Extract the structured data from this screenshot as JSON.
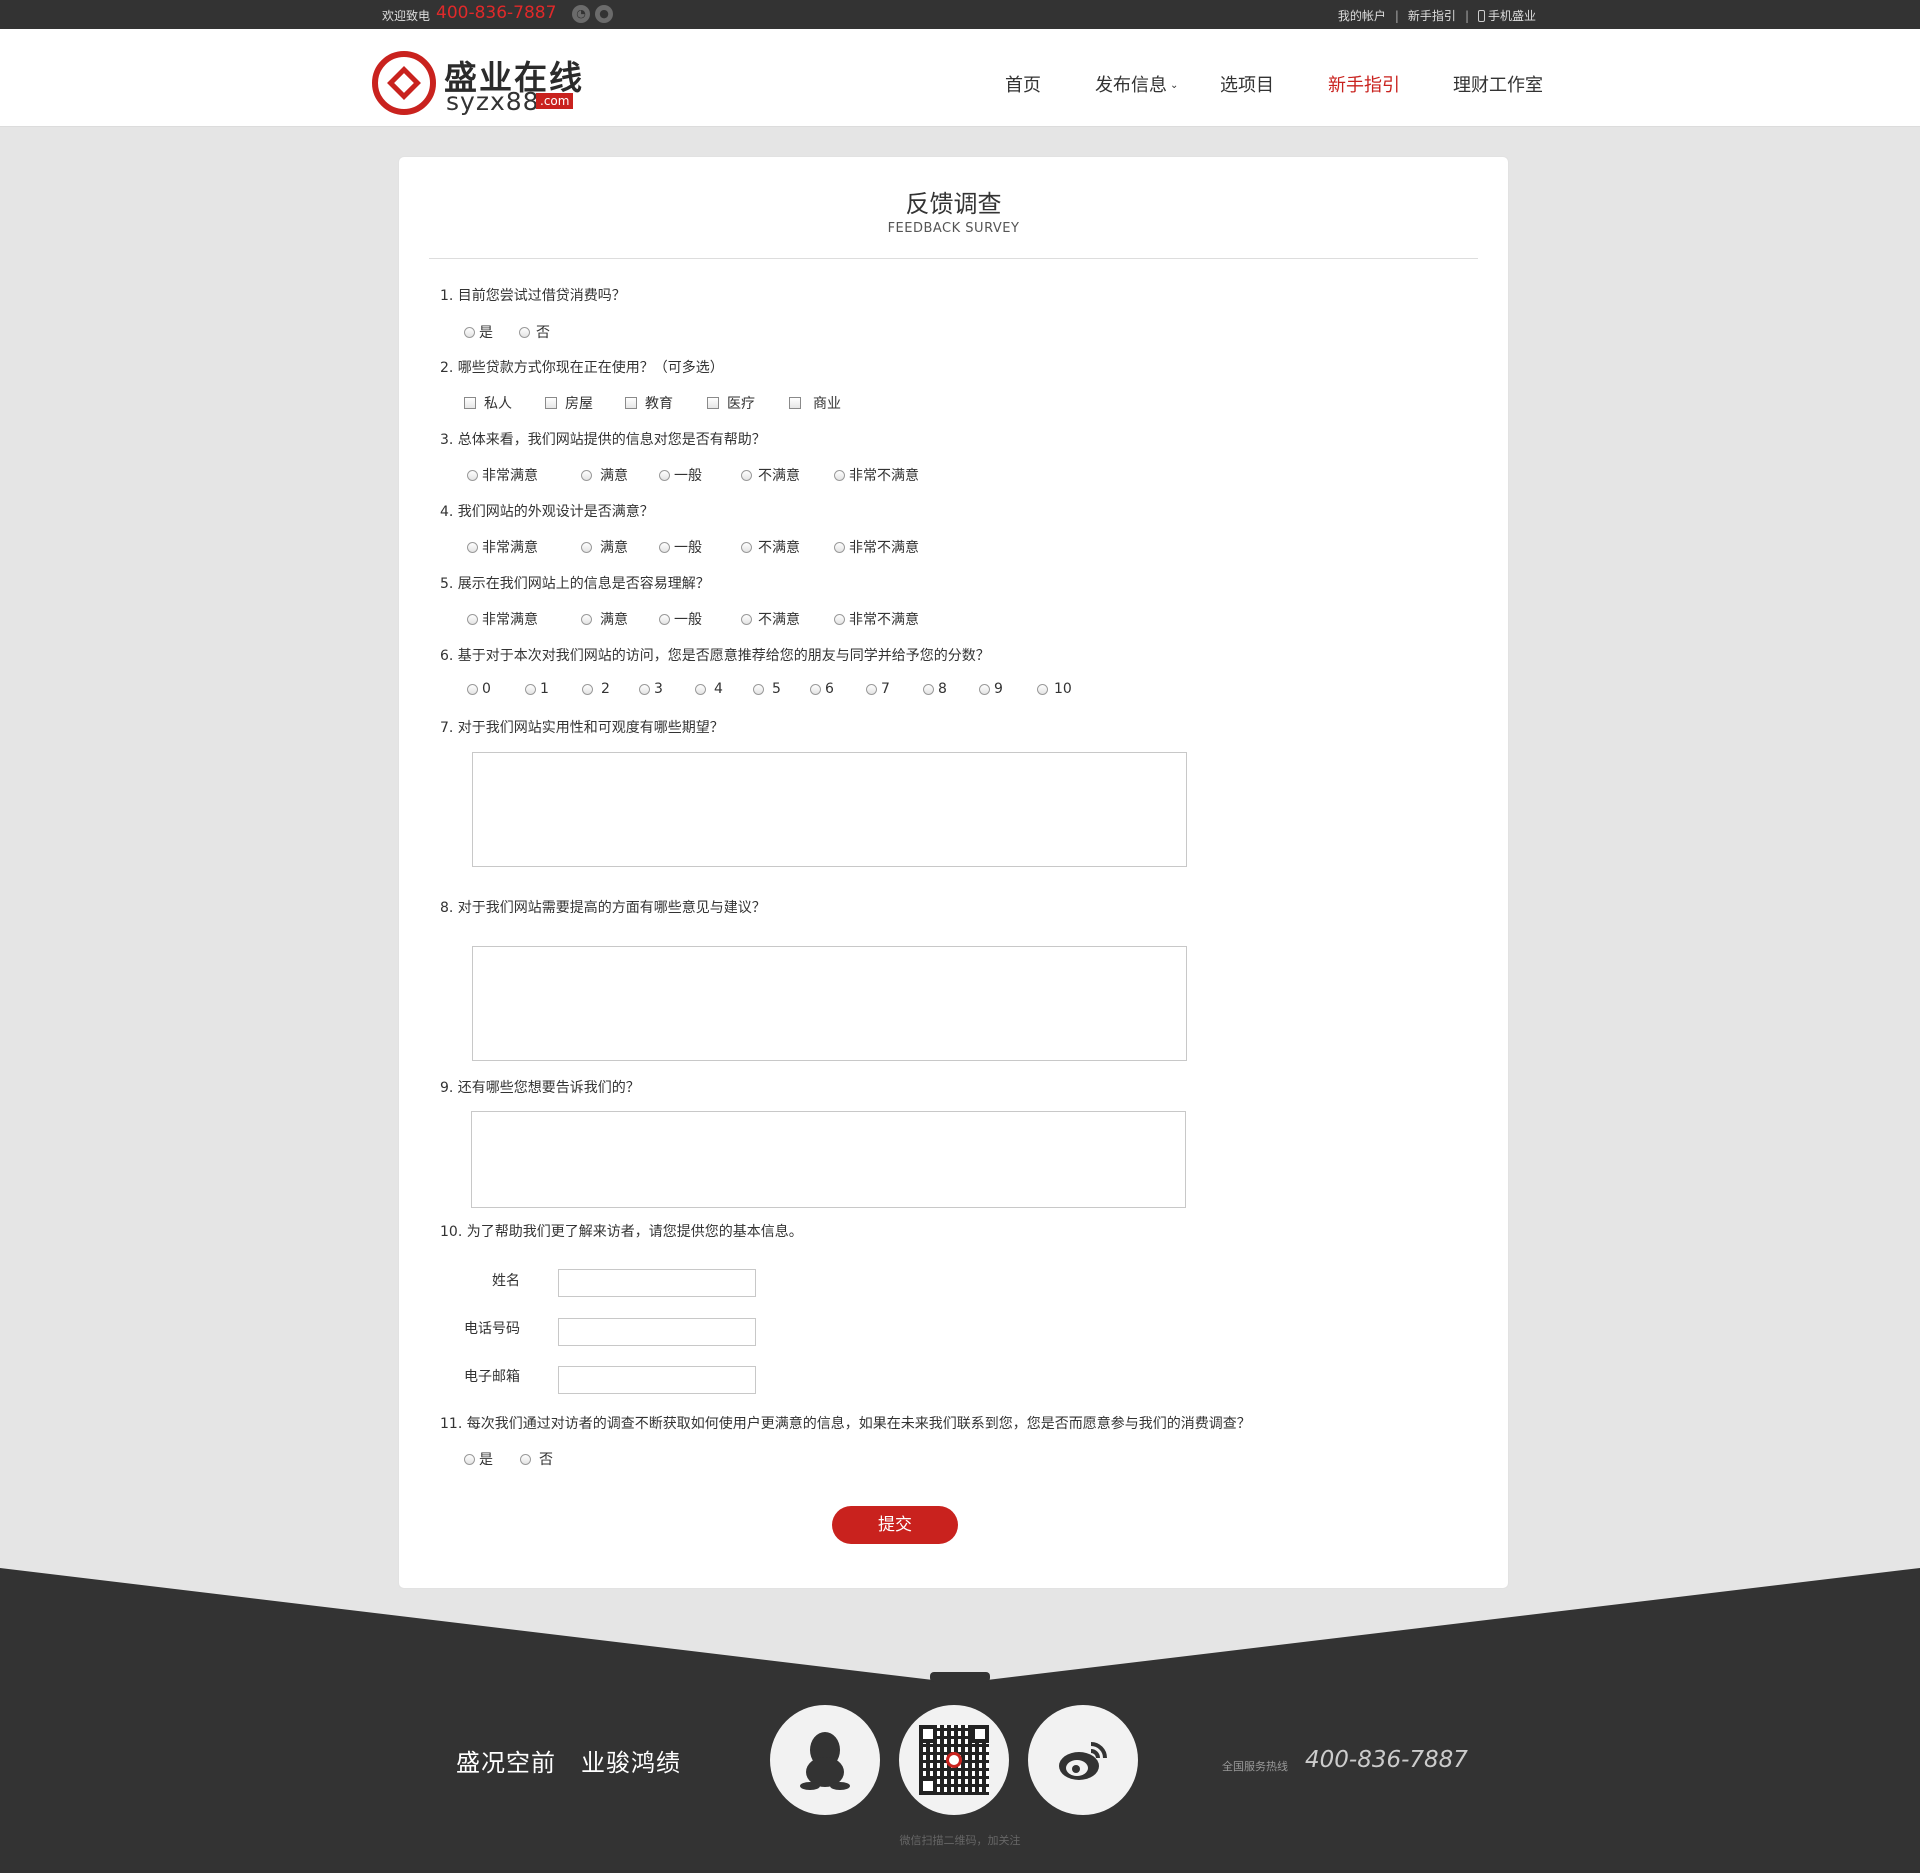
{
  "topbar": {
    "welcome": "欢迎致电",
    "phone": "400-836-7887",
    "links": [
      "我的帐户",
      "新手指引",
      "手机盛业"
    ]
  },
  "header": {
    "logo_cn": "盛业在线",
    "logo_en": "syzx88",
    "logo_com": ".com",
    "nav": [
      "首页",
      "发布信息",
      "选项目",
      "新手指引",
      "理财工作室"
    ],
    "nav_active": "新手指引"
  },
  "survey": {
    "title": "反馈调查",
    "subtitle": "FEEDBACK SURVEY",
    "q1": {
      "text": "1. 目前您尝试过借贷消费吗？",
      "options": [
        "是",
        "否"
      ]
    },
    "q2": {
      "text": "2. 哪些贷款方式你现在正在使用？（可多选）",
      "options": [
        "私人",
        "房屋",
        "教育",
        "医疗",
        "商业"
      ]
    },
    "q3": {
      "text": "3. 总体来看，我们网站提供的信息对您是否有帮助？",
      "options": [
        "非常满意",
        "满意",
        "一般",
        "不满意",
        "非常不满意"
      ]
    },
    "q4": {
      "text": "4. 我们网站的外观设计是否满意？",
      "options": [
        "非常满意",
        "满意",
        "一般",
        "不满意",
        "非常不满意"
      ]
    },
    "q5": {
      "text": "5. 展示在我们网站上的信息是否容易理解？",
      "options": [
        "非常满意",
        "满意",
        "一般",
        "不满意",
        "非常不满意"
      ]
    },
    "q6": {
      "text": "6. 基于对于本次对我们网站的访问，您是否愿意推荐给您的朋友与同学并给予您的分数？",
      "options": [
        "0",
        "1",
        "2",
        "3",
        "4",
        "5",
        "6",
        "7",
        "8",
        "9",
        "10"
      ]
    },
    "q7": {
      "text": "7. 对于我们网站实用性和可观度有哪些期望？"
    },
    "q8": {
      "text": "8. 对于我们网站需要提高的方面有哪些意见与建议？"
    },
    "q9": {
      "text": "9. 还有哪些您想要告诉我们的？"
    },
    "q10": {
      "text": "10. 为了帮助我们更了解来访者，请您提供您的基本信息。",
      "fields": [
        "姓名",
        "电话号码",
        "电子邮箱"
      ]
    },
    "q11": {
      "text": "11. 每次我们通过对访者的调查不断获取如何使用户更满意的信息，如果在未来我们联系到您，您是否而愿意参与我们的消费调查？",
      "options": [
        "是",
        "否"
      ]
    },
    "submit": "提交"
  },
  "footer": {
    "slogan": "盛况空前　业骏鸿绩",
    "hotline_label": "全国服务热线",
    "hotline": "400-836-7887",
    "qr_note": "微信扫描二维码，加关注",
    "icons": [
      "qq-icon",
      "qr-code",
      "weibo-icon"
    ],
    "bg_color": "#333333",
    "accent_color": "#c9221e"
  }
}
